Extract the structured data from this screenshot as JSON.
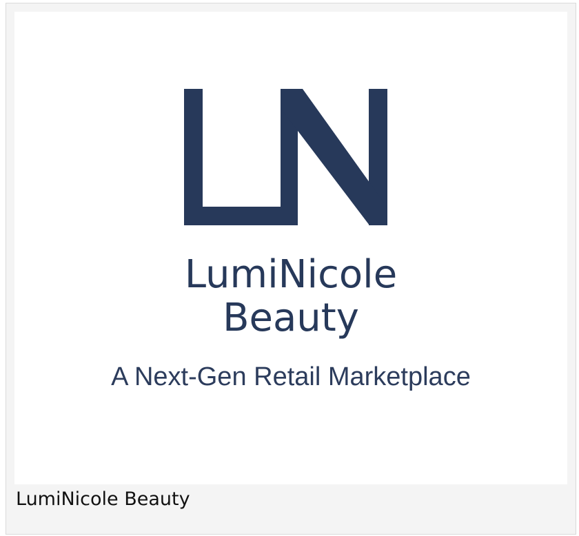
{
  "figure": {
    "logo": {
      "monogram": "LN",
      "brand_line1": "LumiNicole",
      "brand_line2": "Beauty",
      "tagline": "A Next-Gen Retail Marketplace",
      "color": "#27395a"
    },
    "caption": "LumiNicole Beauty"
  }
}
